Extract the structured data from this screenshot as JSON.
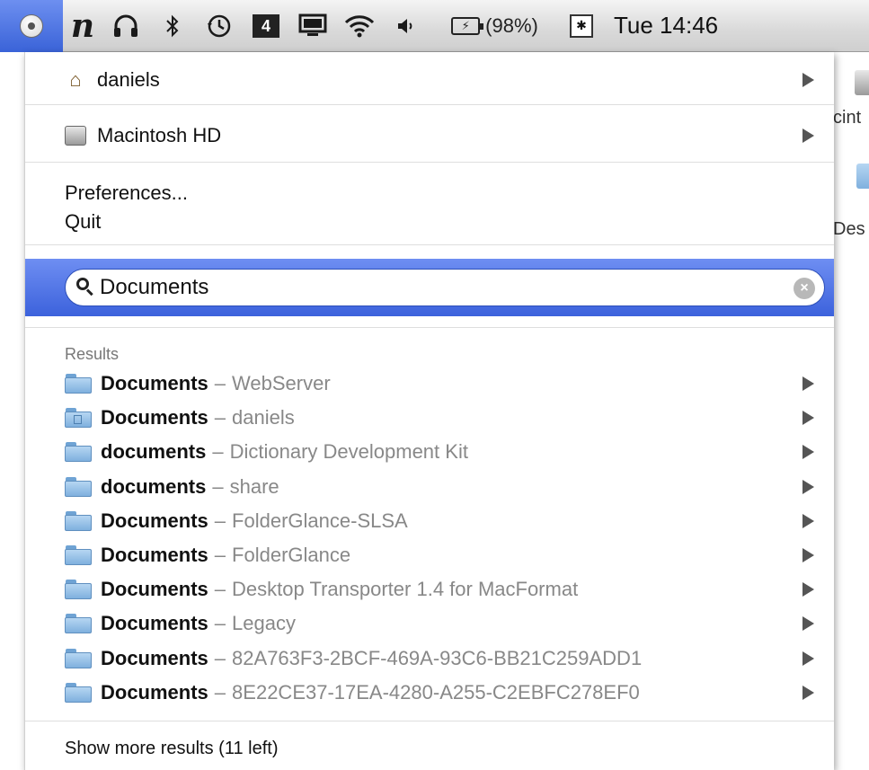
{
  "menubar": {
    "clock": "Tue 14:46",
    "battery_percent_text": "(98%)",
    "icons": [
      "status-menu-icon",
      "n-app-icon",
      "headphones-icon",
      "bluetooth-icon",
      "time-machine-icon",
      "spaces-icon",
      "display-icon",
      "wifi-icon",
      "volume-icon",
      "battery-icon",
      "calendar-icon"
    ],
    "spaces_number": "4"
  },
  "menu": {
    "home_label": "daniels",
    "disk_label": "Macintosh HD",
    "preferences_label": "Preferences...",
    "quit_label": "Quit",
    "search": {
      "value": "Documents"
    },
    "results_label": "Results",
    "results": [
      {
        "name": "Documents",
        "sep": "–",
        "location": "WebServer"
      },
      {
        "name": "Documents",
        "sep": "–",
        "location": "daniels"
      },
      {
        "name": "documents",
        "sep": "–",
        "location": "Dictionary Development Kit"
      },
      {
        "name": "documents",
        "sep": "–",
        "location": "share"
      },
      {
        "name": "Documents",
        "sep": "–",
        "location": "FolderGlance-SLSA"
      },
      {
        "name": "Documents",
        "sep": "–",
        "location": "FolderGlance"
      },
      {
        "name": "Documents",
        "sep": "–",
        "location": "Desktop Transporter 1.4 for MacFormat"
      },
      {
        "name": "Documents",
        "sep": "–",
        "location": "Legacy"
      },
      {
        "name": "Documents",
        "sep": "–",
        "location": "82A763F3-2BCF-469A-93C6-BB21C259ADD1"
      },
      {
        "name": "Documents",
        "sep": "–",
        "location": "8E22CE37-17EA-4280-A255-C2EBFC278EF0"
      }
    ],
    "show_more_label": "Show more results (11 left)"
  },
  "desktop": {
    "label_1": "cint",
    "label_2": "Des"
  },
  "colors": {
    "selection_blue": "#3c62dc",
    "folder_blue": "#7fb0de",
    "secondary_text": "#888888"
  }
}
